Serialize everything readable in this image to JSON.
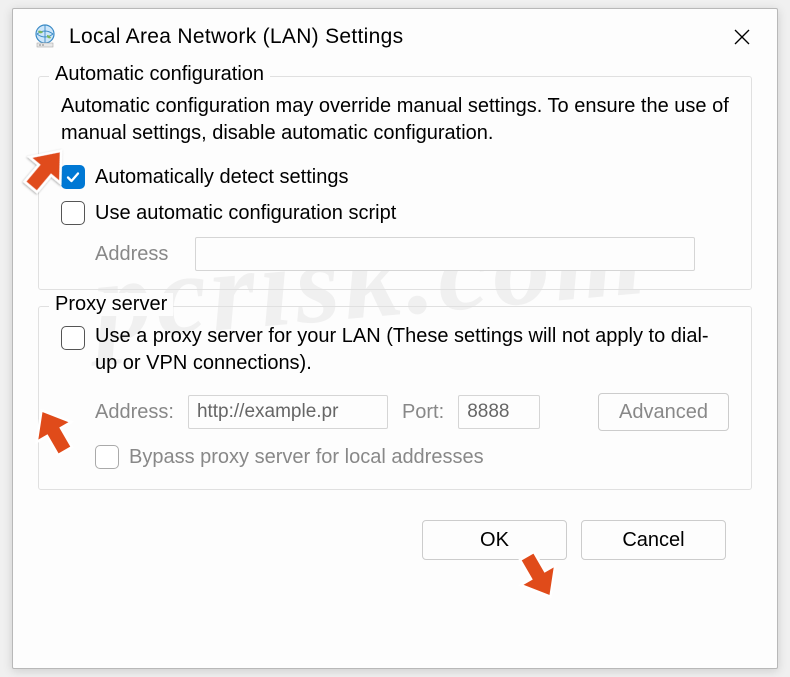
{
  "titlebar": {
    "title": "Local Area Network (LAN) Settings"
  },
  "autoConfig": {
    "legend": "Automatic configuration",
    "description": "Automatic configuration may override manual settings.  To ensure the use of manual settings, disable automatic configuration.",
    "detectLabel": "Automatically detect settings",
    "scriptLabel": "Use automatic configuration script",
    "addressLabel": "Address",
    "addressValue": ""
  },
  "proxy": {
    "legend": "Proxy server",
    "useProxyLabel": "Use a proxy server for your LAN (These settings will not apply to dial-up or VPN connections).",
    "addressLabel": "Address:",
    "addressValue": "http://example.pr",
    "portLabel": "Port:",
    "portValue": "8888",
    "advancedLabel": "Advanced",
    "bypassLabel": "Bypass proxy server for local addresses"
  },
  "buttons": {
    "ok": "OK",
    "cancel": "Cancel"
  },
  "watermark": "pcrisk.com"
}
